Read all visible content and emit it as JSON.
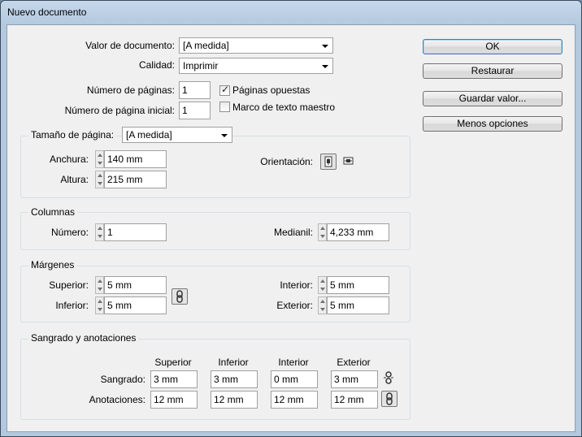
{
  "window": {
    "title": "Nuevo documento"
  },
  "document": {
    "preset_label": "Valor de documento:",
    "preset_value": "[A medida]",
    "intent_label": "Calidad:",
    "intent_value": "Imprimir",
    "pages_label": "Número de páginas:",
    "pages_value": "1",
    "start_page_label": "Número de página inicial:",
    "start_page_value": "1",
    "facing_pages_label": "Páginas opuestas",
    "facing_pages_checked": true,
    "master_text_label": "Marco de texto maestro",
    "master_text_checked": false
  },
  "buttons": {
    "ok": "OK",
    "reset": "Restaurar",
    "save_preset": "Guardar valor...",
    "fewer_options": "Menos opciones"
  },
  "page_size": {
    "label": "Tamaño de página:",
    "value": "[A medida]",
    "width_label": "Anchura:",
    "width_value": "140 mm",
    "height_label": "Altura:",
    "height_value": "215 mm",
    "orientation_label": "Orientación:",
    "orientation_selected": "portrait"
  },
  "columns": {
    "title": "Columnas",
    "number_label": "Número:",
    "number_value": "1",
    "gutter_label": "Medianil:",
    "gutter_value": "4,233 mm"
  },
  "margins": {
    "title": "Márgenes",
    "top_label": "Superior:",
    "top_value": "5 mm",
    "bottom_label": "Inferior:",
    "bottom_value": "5 mm",
    "inside_label": "Interior:",
    "inside_value": "5 mm",
    "outside_label": "Exterior:",
    "outside_value": "5 mm"
  },
  "bleed_slug": {
    "title": "Sangrado y anotaciones",
    "headers": [
      "Superior",
      "Inferior",
      "Interior",
      "Exterior"
    ],
    "bleed_label": "Sangrado:",
    "bleed_values": [
      "3 mm",
      "3 mm",
      "0 mm",
      "3 mm"
    ],
    "slug_label": "Anotaciones:",
    "slug_values": [
      "12 mm",
      "12 mm",
      "12 mm",
      "12 mm"
    ]
  },
  "icons": {
    "portrait": "portrait-orientation-icon",
    "landscape": "landscape-orientation-icon",
    "link": "chain-link-icon",
    "broken_link": "broken-chain-link-icon"
  }
}
